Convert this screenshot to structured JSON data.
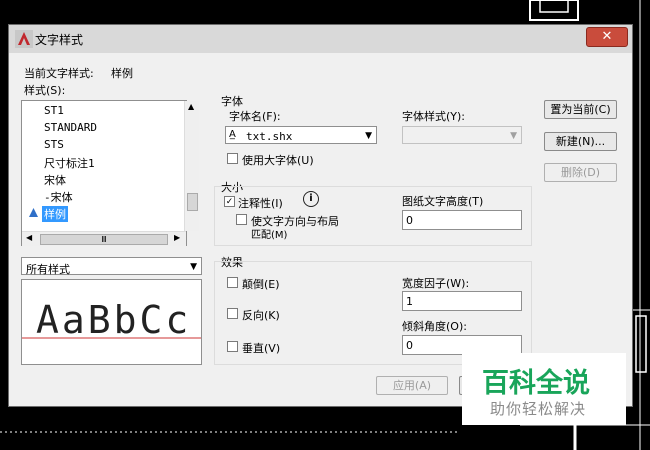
{
  "window": {
    "title": "文字样式",
    "close_glyph": "✕"
  },
  "current_style": {
    "label": "当前文字样式:",
    "value": "样例"
  },
  "styles": {
    "label": "样式(S):",
    "items": [
      "ST1",
      "STANDARD",
      "STS",
      "尺寸标注1",
      "宋体",
      "-宋体",
      "样例"
    ],
    "selected": "样例",
    "scroll_thumb": "Ⅲ"
  },
  "filter": {
    "value": "所有样式"
  },
  "preview": {
    "text": "AaBbCc"
  },
  "font": {
    "group_label": "字体",
    "name_label": "字体名(F):",
    "name_value": "txt.shx",
    "style_label": "字体样式(Y):",
    "style_value": "",
    "big_font_label": "使用大字体(U)",
    "big_font_checked": false
  },
  "size": {
    "group_label": "大小",
    "annotative_label": "注释性(I)",
    "annotative_checked": true,
    "info_icon": "i",
    "match_label_line1": "使文字方向与布局",
    "match_label_line2": "匹配(M)",
    "match_checked": false,
    "height_label": "图纸文字高度(T)",
    "height_value": "0"
  },
  "effects": {
    "group_label": "效果",
    "upside_down": "颠倒(E)",
    "backwards": "反向(K)",
    "vertical": "垂直(V)",
    "width_label": "宽度因子(W):",
    "width_value": "1",
    "oblique_label": "倾斜角度(O):",
    "oblique_value": "0"
  },
  "buttons": {
    "set_current": "置为当前(C)",
    "new": "新建(N)...",
    "delete": "删除(D)",
    "apply": "应用(A)"
  },
  "watermark": {
    "main": "百科全说",
    "sub": "助你轻松解决"
  },
  "colors": {
    "selection": "#3399ff",
    "close": "#c94c3c",
    "watermark": "#19a55a"
  }
}
